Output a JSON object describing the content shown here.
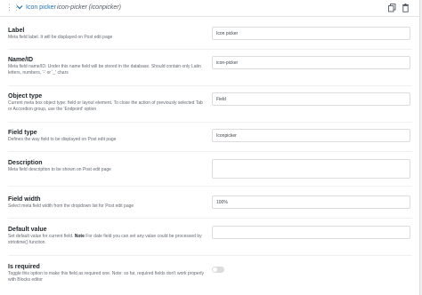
{
  "header": {
    "title": "Icon picker",
    "slug": "icon-picker (iconpicker)"
  },
  "fields": {
    "label": {
      "label": "Label",
      "desc": "Meta field label. It will be displayed on Post edit page",
      "value": "Icon picker"
    },
    "name_id": {
      "label": "Name/ID",
      "desc": "Meta field name/ID. Under this name field will be stored in the database. Should contain only Latin letters, numbers, '-' or '_' chars",
      "value": "icon-picker"
    },
    "object_type": {
      "label": "Object type",
      "desc": "Current meta box object type: field or layout element. To close the action of previously selected Tab or Accordion group, use the 'Endpoint' option",
      "value": "Field"
    },
    "field_type": {
      "label": "Field type",
      "desc": "Defines the way field to be displayed on Post edit page",
      "value": "Iconpicker"
    },
    "description": {
      "label": "Description",
      "desc": "Meta field description to be shown on Post edit page",
      "value": ""
    },
    "field_width": {
      "label": "Field width",
      "desc": "Select meta field width from the dropdown list for Post edit page",
      "value": "100%"
    },
    "default_value": {
      "label": "Default value",
      "desc_before": "Set default value for current field.",
      "desc_note": "Note",
      "desc_after": " For date field you can set any value could be processed by strtotime() function.",
      "value": ""
    },
    "is_required": {
      "label": "Is required",
      "desc": "Toggle this option to make this field as required one. Note: so far, required fields don't work properly with Blocks editor",
      "value": false
    }
  }
}
